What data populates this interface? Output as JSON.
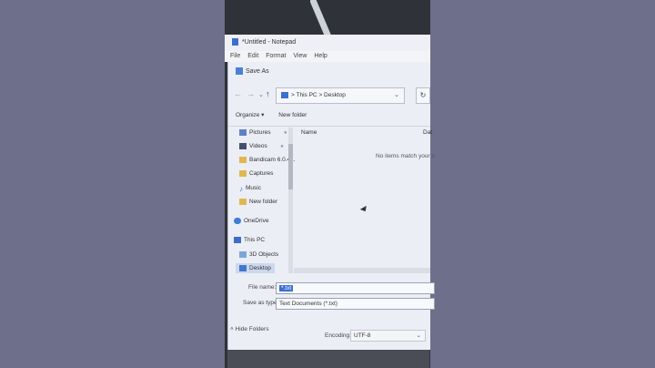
{
  "notepad": {
    "title": "*Untitled - Notepad",
    "menu": [
      "File",
      "Edit",
      "Format",
      "View",
      "Help"
    ]
  },
  "dialog": {
    "title": "Save As",
    "address": {
      "root": "This PC",
      "sep": ">",
      "folder": "Desktop"
    },
    "toolbar": {
      "organize": "Organize ▾",
      "new_folder": "New folder"
    },
    "nav_items": [
      "Pictures",
      "Videos",
      "Bandicam 6.0.4...",
      "Captures",
      "Music",
      "New folder",
      "OneDrive",
      "This PC",
      "3D Objects",
      "Desktop"
    ],
    "columns": {
      "name": "Name",
      "date": "Dat"
    },
    "empty_message": "No items match your s",
    "file_name_label": "File name:",
    "file_name_value": "*.txt",
    "save_type_label": "Save as type:",
    "save_type_value": "Text Documents (*.txt)",
    "hide_folders": "Hide Folders",
    "encoding_label": "Encoding:",
    "encoding_value": "UTF-8"
  },
  "colors": {
    "accent": "#3b6fd1",
    "background": "#6e6f8b"
  }
}
